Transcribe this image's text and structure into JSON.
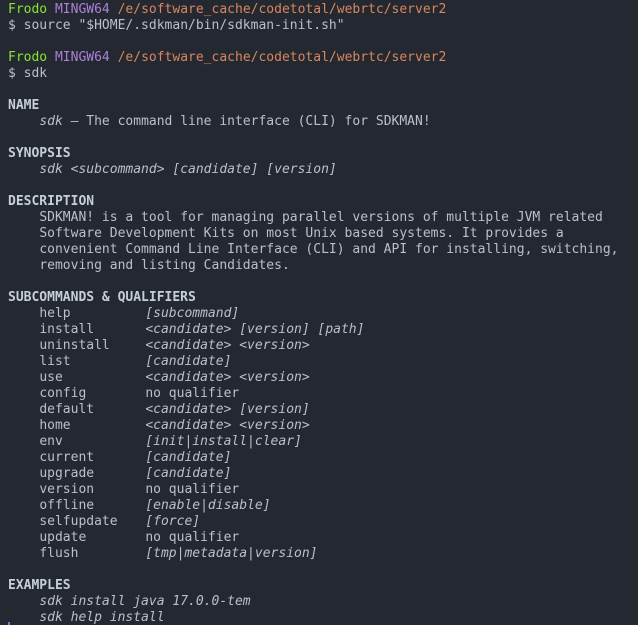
{
  "terminal": {
    "colors": {
      "background": "#242830",
      "foreground": "#b9c0cb",
      "user": "#8ae234",
      "host": "#ad7fdb",
      "path": "#d7875f",
      "header": "#c7cedb"
    },
    "prompt1": {
      "user": "Frodo",
      "host": "MINGW64",
      "path": "/e/software_cache/codetotal/webrtc/server2",
      "symbol": "$",
      "command": "source \"$HOME/.sdkman/bin/sdkman-init.sh\""
    },
    "prompt2": {
      "user": "Frodo",
      "host": "MINGW64",
      "path": "/e/software_cache/codetotal/webrtc/server2",
      "symbol": "$",
      "command": "sdk"
    },
    "output": {
      "name": {
        "header": "NAME",
        "program": "sdk",
        "dash": "–",
        "description": "The command line interface (CLI) for SDKMAN!"
      },
      "synopsis": {
        "header": "SYNOPSIS",
        "usage": "sdk <subcommand> [candidate] [version]"
      },
      "description": {
        "header": "DESCRIPTION",
        "lines": [
          "SDKMAN! is a tool for managing parallel versions of multiple JVM related",
          "Software Development Kits on most Unix based systems. It provides a",
          "convenient Command Line Interface (CLI) and API for installing, switching,",
          "removing and listing Candidates."
        ]
      },
      "subcommands": {
        "header": "SUBCOMMANDS & QUALIFIERS",
        "rows": [
          {
            "name": "help",
            "qualifier": "[subcommand]",
            "italic": true
          },
          {
            "name": "install",
            "qualifier": "<candidate> [version] [path]",
            "italic": true
          },
          {
            "name": "uninstall",
            "qualifier": "<candidate> <version>",
            "italic": true
          },
          {
            "name": "list",
            "qualifier": "[candidate]",
            "italic": true
          },
          {
            "name": "use",
            "qualifier": "<candidate> <version>",
            "italic": true
          },
          {
            "name": "config",
            "qualifier": "no qualifier",
            "italic": false
          },
          {
            "name": "default",
            "qualifier": "<candidate> [version]",
            "italic": true
          },
          {
            "name": "home",
            "qualifier": "<candidate> <version>",
            "italic": true
          },
          {
            "name": "env",
            "qualifier": "[init|install|clear]",
            "italic": true
          },
          {
            "name": "current",
            "qualifier": "[candidate]",
            "italic": true
          },
          {
            "name": "upgrade",
            "qualifier": "[candidate]",
            "italic": true
          },
          {
            "name": "version",
            "qualifier": "no qualifier",
            "italic": false
          },
          {
            "name": "offline",
            "qualifier": "[enable|disable]",
            "italic": true
          },
          {
            "name": "selfupdate",
            "qualifier": "[force]",
            "italic": true
          },
          {
            "name": "update",
            "qualifier": "no qualifier",
            "italic": false
          },
          {
            "name": "flush",
            "qualifier": "[tmp|metadata|version]",
            "italic": true
          }
        ]
      },
      "examples": {
        "header": "EXAMPLES",
        "lines": [
          "sdk install java 17.0.0-tem",
          "sdk help install"
        ]
      }
    }
  }
}
